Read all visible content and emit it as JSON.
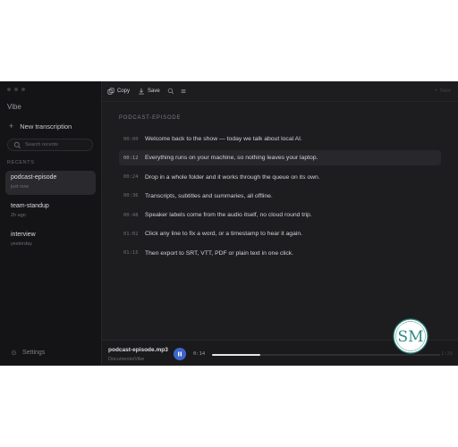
{
  "app": {
    "name": "Vibe"
  },
  "sidebar": {
    "new_transcription": "New transcription",
    "search_placeholder": "Search recents",
    "recents_label": "RECENTS",
    "recents": [
      {
        "title": "podcast-episode",
        "time": "just now",
        "active": true
      },
      {
        "title": "team-standup",
        "time": "2h ago",
        "active": false
      },
      {
        "title": "interview",
        "time": "yesterday",
        "active": false
      }
    ],
    "settings_label": "Settings"
  },
  "toolbar": {
    "copy_label": "Copy",
    "save_label": "Save",
    "right_label": "New"
  },
  "transcript": {
    "title": "PODCAST-EPISODE",
    "lines": [
      {
        "ts": "00:00",
        "text": "Welcome back to the show — today we talk about local AI.",
        "active": false
      },
      {
        "ts": "00:12",
        "text": "Everything runs on your machine, so nothing leaves your laptop.",
        "active": true
      },
      {
        "ts": "00:24",
        "text": "Drop in a whole folder and it works through the queue on its own.",
        "active": false
      },
      {
        "ts": "00:36",
        "text": "Transcripts, subtitles and summaries, all offline.",
        "active": false
      },
      {
        "ts": "00:48",
        "text": "Speaker labels come from the audio itself, no cloud round trip.",
        "active": false
      },
      {
        "ts": "01:02",
        "text": "Click any line to fix a word, or a timestamp to hear it again.",
        "active": false
      },
      {
        "ts": "01:15",
        "text": "Then export to SRT, VTT, PDF or plain text in one click.",
        "active": false
      }
    ]
  },
  "player": {
    "filename": "podcast-episode.mp3",
    "path": "Documents/Vibe",
    "current_time": "0:14",
    "duration": "1:28",
    "progress": 0.21
  },
  "logo": {
    "text": "SM",
    "color": "#2f8a80"
  },
  "colors": {
    "accent": "#3d66c9",
    "background": "#1d1d20",
    "sidebar": "#141416"
  }
}
